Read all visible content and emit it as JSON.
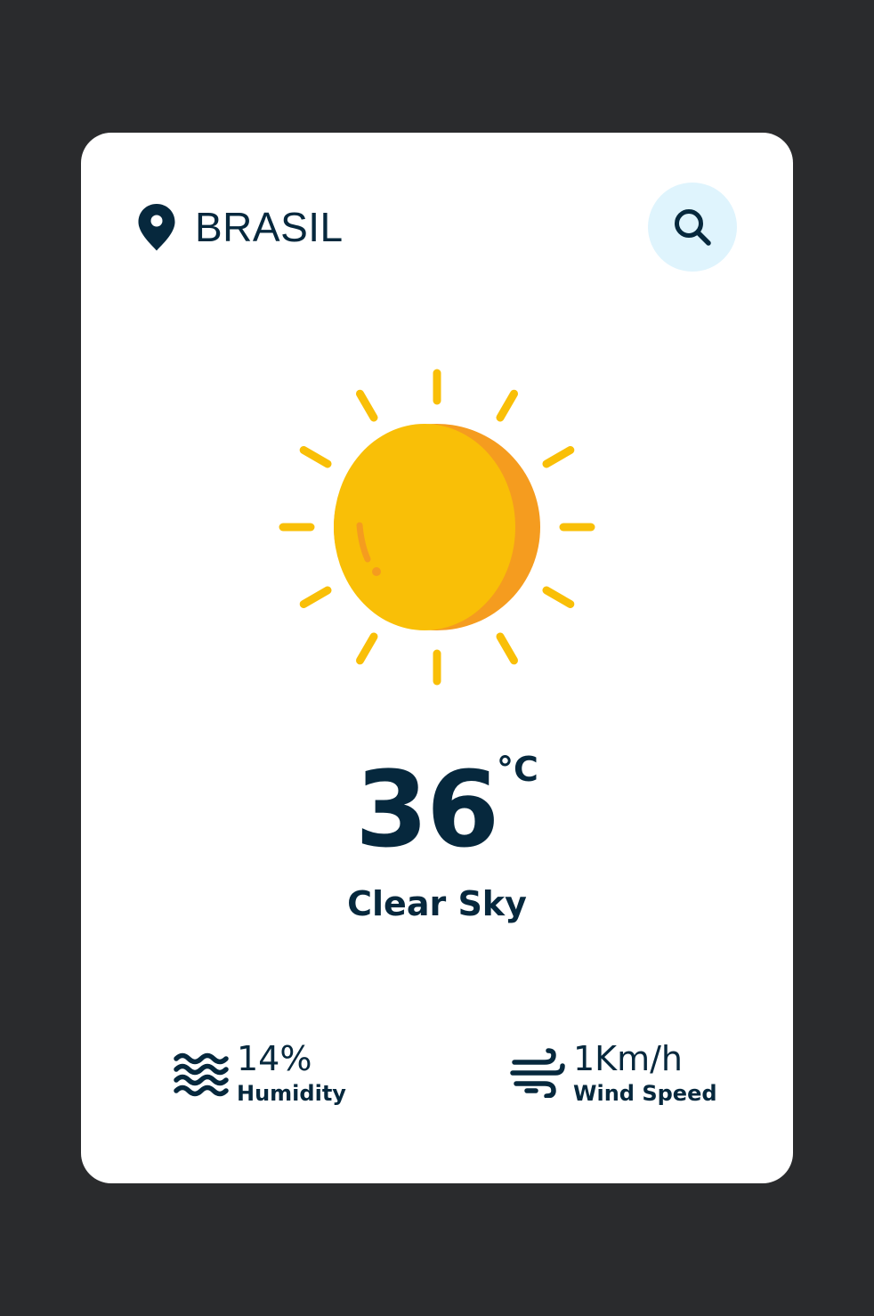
{
  "location": {
    "city": "BRASIL",
    "pin_icon": "location-pin-icon"
  },
  "search": {
    "icon": "search-icon",
    "background": "#dff4fd"
  },
  "weather": {
    "icon": "sun-icon",
    "temperature": "36",
    "unit": "°C",
    "description": "Clear Sky"
  },
  "details": {
    "humidity": {
      "icon": "waves-icon",
      "value": "14%",
      "label": "Humidity"
    },
    "wind": {
      "icon": "wind-icon",
      "value": "1Km/h",
      "label": "Wind Speed"
    }
  },
  "colors": {
    "page_background": "#2a2b2d",
    "card_background": "#ffffff",
    "text": "#06283d",
    "sun": "#f9bf07",
    "sun_shade": "#f59c1f"
  }
}
